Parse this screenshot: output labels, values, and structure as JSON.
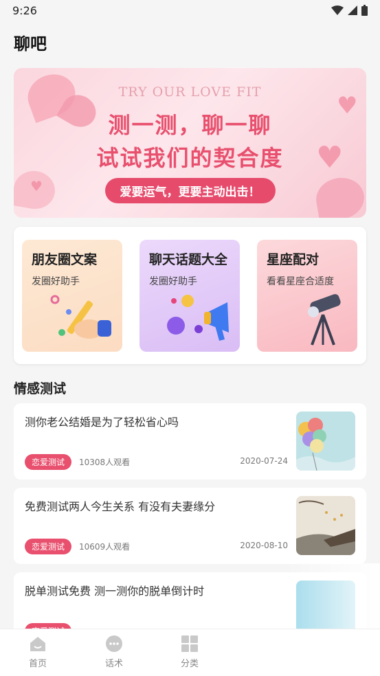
{
  "status": {
    "time": "9:26"
  },
  "page_title": "聊吧",
  "banner": {
    "eng": "TRY OUR LOVE FIT",
    "line1": "测一测，聊一聊",
    "line2": "试试我们的契合度",
    "pill": "爱要运气，更要主动出击！"
  },
  "tools": [
    {
      "title": "朋友圈文案",
      "sub": "发圈好助手"
    },
    {
      "title": "聊天话题大全",
      "sub": "发圈好助手"
    },
    {
      "title": "星座配对",
      "sub": "看看星座合适度"
    }
  ],
  "section_title": "情感测试",
  "articles": [
    {
      "title": "测你老公结婚是为了轻松省心吗",
      "tag": "恋爱测试",
      "views": "10308人观看",
      "date": "2020-07-24"
    },
    {
      "title": "免费测试两人今生关系 有没有夫妻缘分",
      "tag": "恋爱测试",
      "views": "10609人观看",
      "date": "2020-08-10"
    },
    {
      "title": "脱单测试免费 测一测你的脱单倒计时",
      "tag": "恋爱测试",
      "views": "",
      "date": ""
    }
  ],
  "tabbar": [
    {
      "label": "首页",
      "icon": "home-icon"
    },
    {
      "label": "话术",
      "icon": "chat-bubble-icon"
    },
    {
      "label": "分类",
      "icon": "grid-icon"
    }
  ],
  "colors": {
    "accent": "#e8506e",
    "banner_pink": "#fbd6de"
  }
}
